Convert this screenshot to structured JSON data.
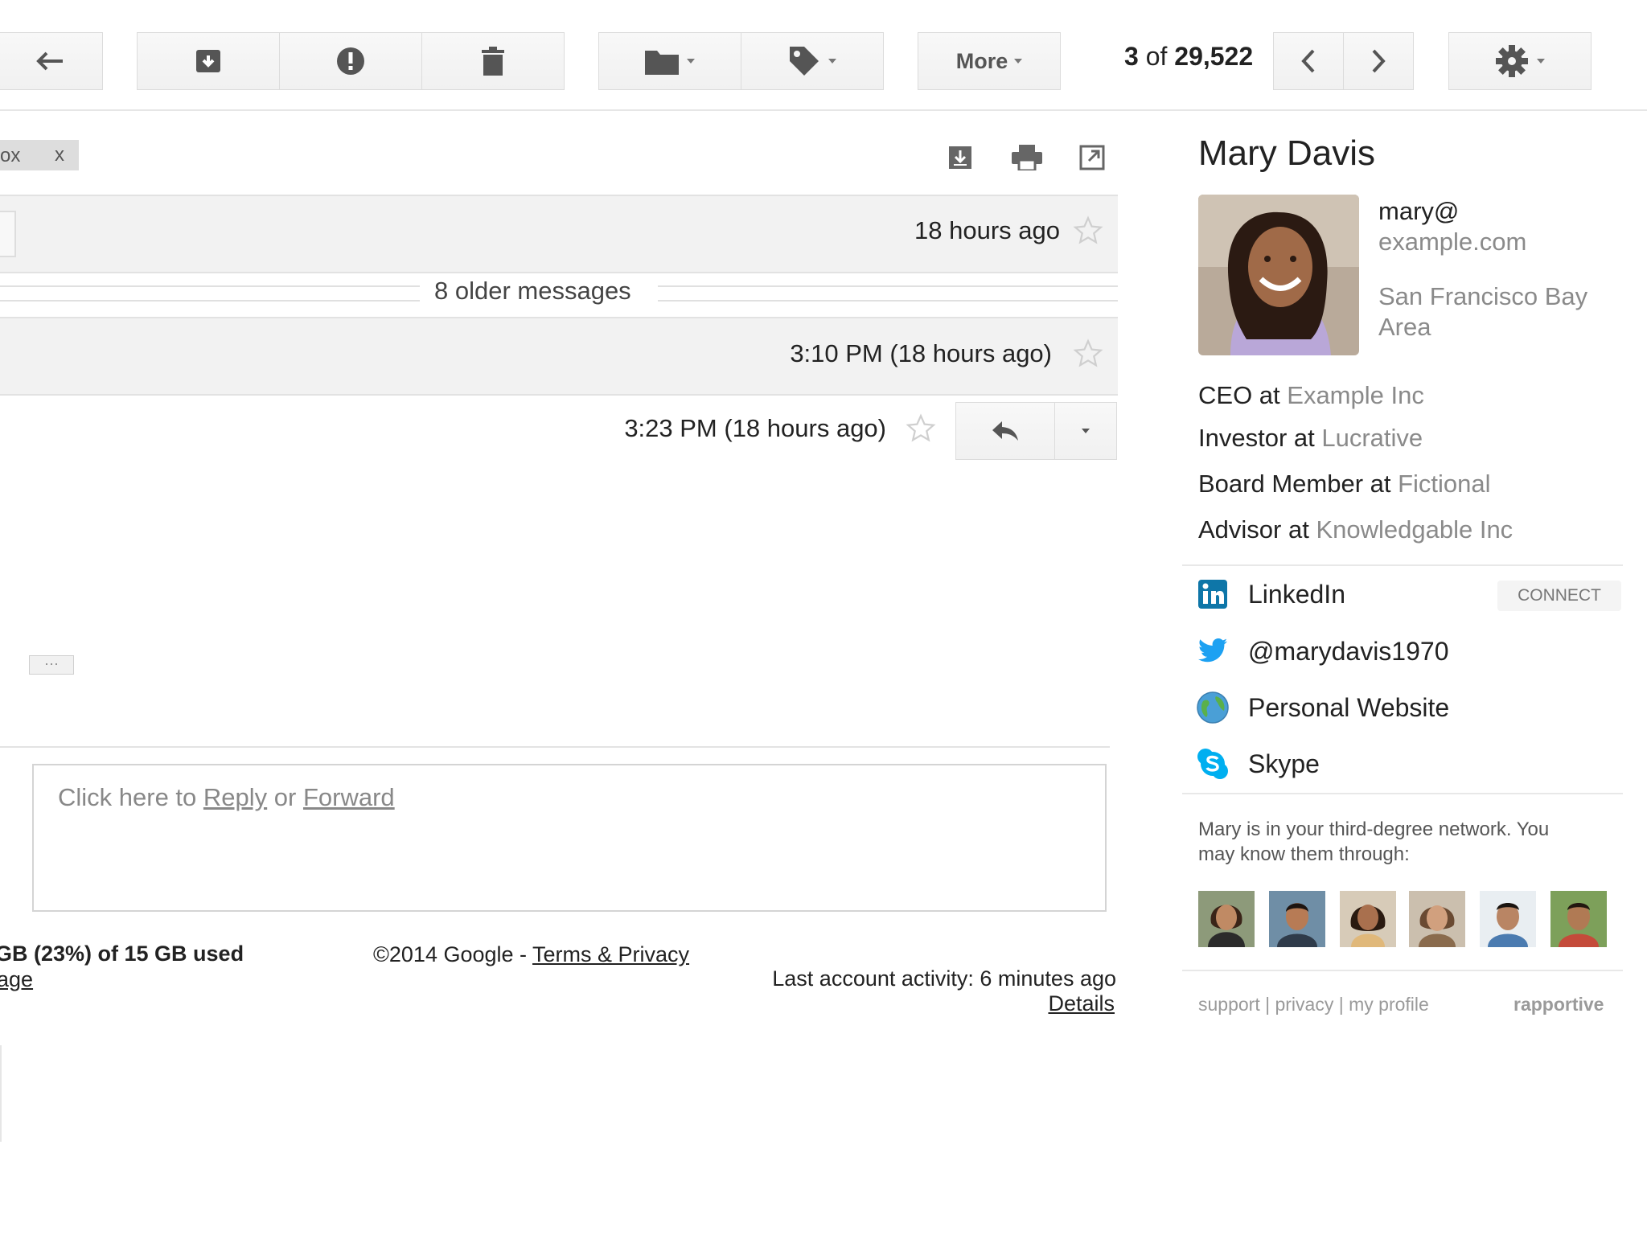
{
  "toolbar": {
    "more_label": "More",
    "pagination_current": "3",
    "pagination_of": "of",
    "pagination_total": "29,522"
  },
  "label_chip": {
    "text": "ox",
    "close": "x"
  },
  "thread": {
    "msg1_time": "18 hours ago",
    "older_messages": "8 older messages",
    "msg2_time": "3:10 PM (18 hours ago)",
    "msg3_time": "3:23 PM (18 hours ago)",
    "ellipsis": "···"
  },
  "reply": {
    "prefix": "Click here to ",
    "reply_link": "Reply",
    "or": " or ",
    "forward_link": "Forward"
  },
  "footer": {
    "storage": "GB (23%) of 15 GB used",
    "manage": "age",
    "copyright": "©2014 Google - ",
    "terms": "Terms & Privacy",
    "activity": "Last account activity: 6 minutes ago",
    "details": "Details"
  },
  "sidebar": {
    "name": "Mary Davis",
    "email_line1": "mary@",
    "email_line2": "example.com",
    "location_line1": "San Francisco Bay",
    "location_line2": "Area",
    "roles": [
      {
        "title": "CEO at ",
        "company": "Example Inc"
      },
      {
        "title": "Investor at ",
        "company": "Lucrative"
      },
      {
        "title": "Board Member at ",
        "company": "Fictional"
      },
      {
        "title": "Advisor at ",
        "company": "Knowledgable Inc"
      }
    ],
    "social": {
      "linkedin": "LinkedIn",
      "connect": "CONNECT",
      "twitter": "@marydavis1970",
      "website": "Personal Website",
      "skype": "Skype"
    },
    "network_text_line1": "Mary is in your third-degree network. You",
    "network_text_line2": "may know them through:",
    "links": {
      "support": "support",
      "sep": " | ",
      "privacy": "privacy",
      "profile": "my profile"
    },
    "brand": "rapportive"
  },
  "colors": {
    "linkedin": "#0e76a8",
    "twitter": "#1da1f2",
    "skype": "#00aff0",
    "star": "#cfcfcf"
  }
}
